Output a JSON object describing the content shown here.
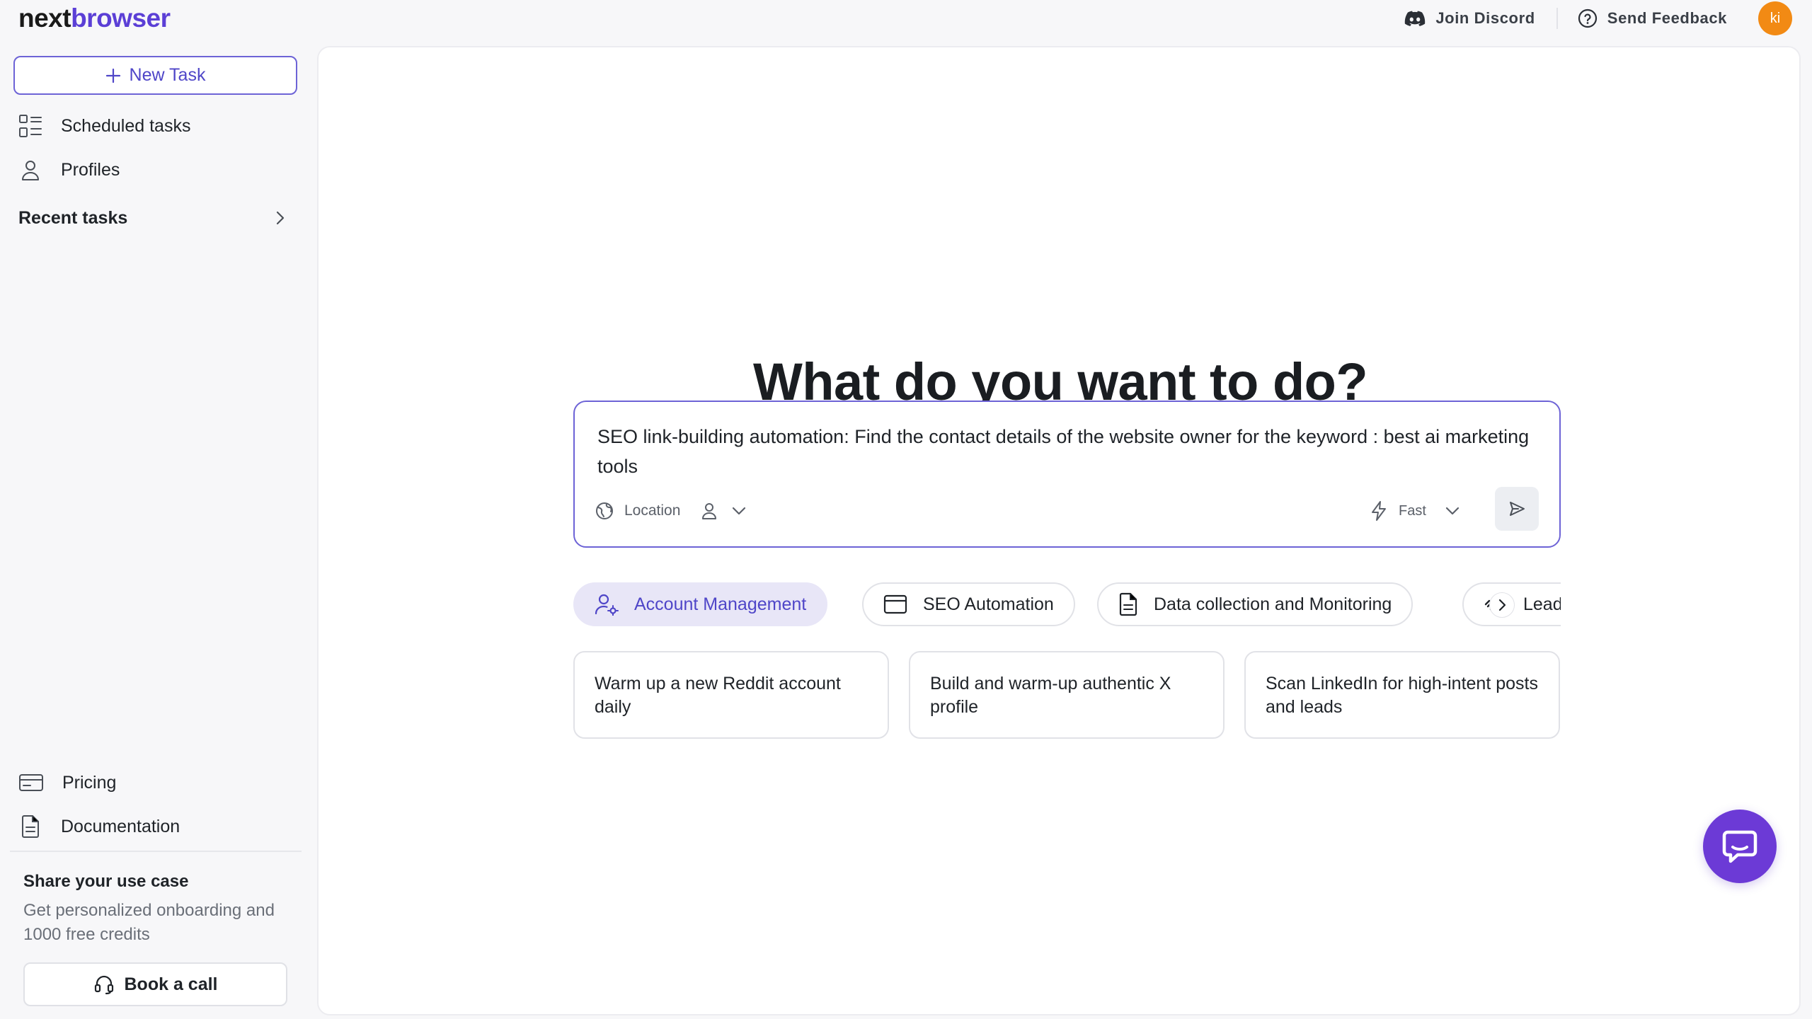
{
  "brand": {
    "logo_dark": "next",
    "logo_accent": "browser",
    "logo_rest": ""
  },
  "header": {
    "discord_label": "Join Discord",
    "feedback_label": "Send Feedback",
    "avatar_initials": "ki"
  },
  "sidebar": {
    "new_task_label": "New Task",
    "scheduled_label": "Scheduled tasks",
    "profiles_label": "Profiles",
    "recent_label": "Recent tasks",
    "pricing_label": "Pricing",
    "docs_label": "Documentation",
    "share_title": "Share your use case",
    "share_desc": "Get personalized onboarding and 1000 free credits",
    "book_call_label": "Book a call"
  },
  "main": {
    "headline": "What do you want to do?",
    "prompt_text": "SEO link-building automation: Find the contact details of the website owner for the keyword : best ai marketing tools",
    "location_label": "Location",
    "speed_label": "Fast",
    "categories": [
      {
        "label": "Account Management",
        "icon": "user-gear-icon"
      },
      {
        "label": "SEO Automation",
        "icon": "browser-window-icon"
      },
      {
        "label": "Data collection and Monitoring",
        "icon": "document-icon"
      },
      {
        "label": "Lead",
        "icon": "magnet-icon"
      }
    ],
    "suggestions": [
      "Warm up a new Reddit account daily",
      "Build and warm-up authentic X profile",
      "Scan LinkedIn for high-intent posts and leads"
    ]
  },
  "colors": {
    "accent": "#5b3fd6",
    "avatar": "#f28a14",
    "chat_fab": "#6c3ad6",
    "active_chip_bg": "#e8e6f7"
  }
}
